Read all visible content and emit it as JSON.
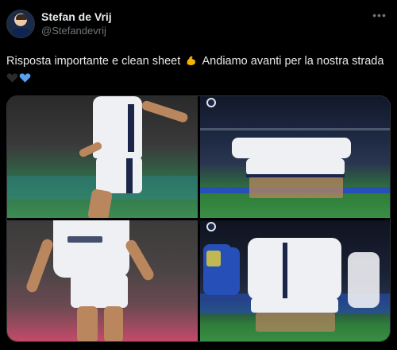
{
  "author": {
    "name": "Stefan de Vrij",
    "handle": "@Stefandevrij"
  },
  "more_icon": "more-horizontal-icon",
  "tweet": {
    "text_part1": "Risposta importante e clean sheet",
    "text_part2": "Andiamo avanti per la nostra strada",
    "emoji_1": "flexed-biceps",
    "emoji_2": "black-heart",
    "emoji_3": "blue-heart"
  },
  "media": {
    "count": 4,
    "photos": [
      {
        "subject": "player-kicking-ball"
      },
      {
        "subject": "team-photo"
      },
      {
        "subject": "player-close-up"
      },
      {
        "subject": "team-celebration"
      }
    ]
  },
  "colors": {
    "background": "#000000",
    "text_primary": "#e7e9ea",
    "text_secondary": "#71767b",
    "border": "#2f3336",
    "heart_blue": "#5aa0f0"
  }
}
